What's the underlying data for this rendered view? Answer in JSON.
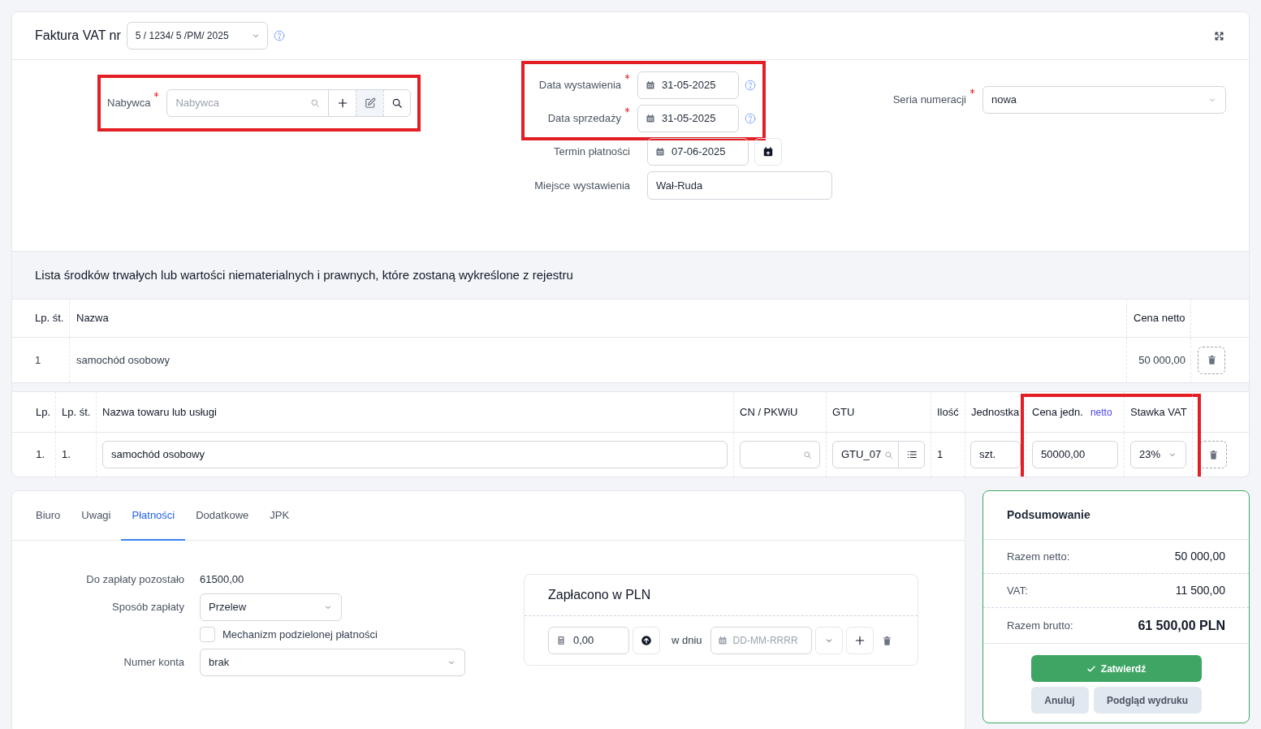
{
  "header": {
    "title": "Faktura VAT nr",
    "number": "5 / 1234/ 5 /PM/ 2025"
  },
  "buyer": {
    "label": "Nabywca",
    "required": true,
    "placeholder": "Nabywca",
    "highlighted": true
  },
  "fields": [
    {
      "label": "Data wystawienia",
      "required": true,
      "value": "31-05-2025",
      "kind": "date",
      "help": true,
      "calendar_button": false,
      "highlighted": true
    },
    {
      "label": "Data sprzedaży",
      "required": true,
      "value": "31-05-2025",
      "kind": "date",
      "help": true,
      "calendar_button": false,
      "highlighted": true
    },
    {
      "label": "Termin płatności",
      "required": false,
      "value": "07-06-2025",
      "kind": "date",
      "help": false,
      "calendar_button": true,
      "highlighted": false
    },
    {
      "label": "Miejsce wystawienia",
      "required": false,
      "value": "Wał-Ruda",
      "kind": "text",
      "help": false,
      "calendar_button": false,
      "highlighted": false
    }
  ],
  "series": {
    "label": "Seria numeracji",
    "required": true,
    "value": "nowa"
  },
  "assets": {
    "title": "Lista środków trwałych lub wartości niematerialnych i prawnych, które zostaną wykreślone z rejestru",
    "columns": [
      "Lp. śt.",
      "Nazwa",
      "Cena netto"
    ],
    "rows": [
      {
        "lp": "1",
        "name": "samochód osobowy",
        "price": "50 000,00"
      }
    ]
  },
  "items": {
    "columns": [
      {
        "label": "Lp.",
        "highlighted": false
      },
      {
        "label": "Lp. śt.",
        "highlighted": false
      },
      {
        "label": "Nazwa towaru lub usługi",
        "highlighted": false
      },
      {
        "label": "CN / PKWiU",
        "highlighted": false
      },
      {
        "label": "GTU",
        "highlighted": false
      },
      {
        "label": "Ilość",
        "highlighted": false
      },
      {
        "label": "Jednostka",
        "highlighted": false
      },
      {
        "label": "Cena jedn.",
        "tag": "netto",
        "highlighted": true
      },
      {
        "label": "Stawka VAT",
        "highlighted": true
      }
    ],
    "rows": [
      {
        "lp": "1.",
        "lp_st": "1.",
        "name": "samochód osobowy",
        "cn": "",
        "gtu": "GTU_07",
        "qty": "1",
        "unit": "szt.",
        "price": "50000,00",
        "vat": "23%"
      }
    ]
  },
  "tabs": [
    {
      "label": "Biuro",
      "selected": false
    },
    {
      "label": "Uwagi",
      "selected": false
    },
    {
      "label": "Płatności",
      "selected": true
    },
    {
      "label": "Dodatkowe",
      "selected": false
    },
    {
      "label": "JPK",
      "selected": false
    }
  ],
  "payment": {
    "remaining_label": "Do zapłaty pozostało",
    "remaining": "61500,00",
    "method_label": "Sposób zapłaty",
    "method": "Przelew",
    "split_label": "Mechanizm podzielonej płatności",
    "split_checked": false,
    "account_label": "Numer konta",
    "account": "brak"
  },
  "paid": {
    "title": "Zapłacono w PLN",
    "amount": "0,00",
    "date_label": "w dniu",
    "date_placeholder": "DD-MM-RRRR"
  },
  "summary": {
    "title": "Podsumowanie",
    "rows": [
      {
        "label": "Razem netto:",
        "value": "50 000,00",
        "kind": "line"
      },
      {
        "label": "VAT:",
        "value": "11 500,00",
        "kind": "line"
      },
      {
        "label": "Razem brutto:",
        "value": "61 500,00 PLN",
        "kind": "total"
      }
    ],
    "confirm": "Zatwierdź",
    "cancel": "Anuluj",
    "preview": "Podgląd wydruku"
  }
}
